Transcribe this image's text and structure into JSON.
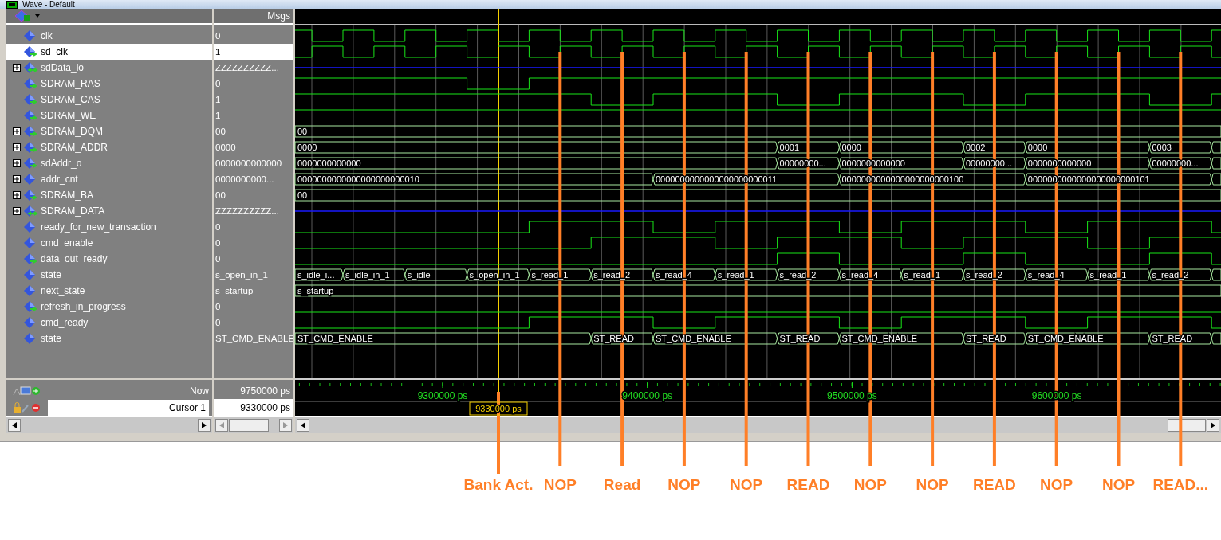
{
  "window": {
    "title": "Wave - Default"
  },
  "header": {
    "values_heading": "Msgs"
  },
  "signals": [
    {
      "name": "clk",
      "value": "0",
      "output": false,
      "bidirectional": false,
      "expandable": false,
      "selected": false,
      "kind": "bit"
    },
    {
      "name": "sd_clk",
      "value": "1",
      "output": true,
      "bidirectional": false,
      "expandable": false,
      "selected": true,
      "kind": "bit"
    },
    {
      "name": "sdData_io",
      "value": "ZZZZZZZZZZ...",
      "output": false,
      "bidirectional": true,
      "expandable": true,
      "selected": false,
      "kind": "hiz"
    },
    {
      "name": "SDRAM_RAS",
      "value": "0",
      "output": true,
      "bidirectional": false,
      "expandable": false,
      "selected": false,
      "kind": "bit"
    },
    {
      "name": "SDRAM_CAS",
      "value": "1",
      "output": true,
      "bidirectional": false,
      "expandable": false,
      "selected": false,
      "kind": "bit"
    },
    {
      "name": "SDRAM_WE",
      "value": "1",
      "output": true,
      "bidirectional": false,
      "expandable": false,
      "selected": false,
      "kind": "bit"
    },
    {
      "name": "SDRAM_DQM",
      "value": "00",
      "output": true,
      "bidirectional": false,
      "expandable": true,
      "selected": false,
      "kind": "bus",
      "segments": [
        "00"
      ]
    },
    {
      "name": "SDRAM_ADDR",
      "value": "0000",
      "output": true,
      "bidirectional": false,
      "expandable": true,
      "selected": false,
      "kind": "bus",
      "segments": [
        "0000",
        "0001",
        "0000",
        "0002",
        "0000",
        "0003"
      ]
    },
    {
      "name": "sdAddr_o",
      "value": "0000000000000",
      "output": true,
      "bidirectional": false,
      "expandable": true,
      "selected": false,
      "kind": "bus",
      "segments": [
        "0000000000000",
        "00000000...",
        "0000000000000",
        "00000000...",
        "0000000000000",
        "00000000..."
      ]
    },
    {
      "name": "addr_cnt",
      "value": "0000000000...",
      "output": false,
      "bidirectional": false,
      "expandable": true,
      "selected": false,
      "kind": "bus",
      "segments": [
        "0000000000000000000000010",
        "0000000000000000000000011",
        "0000000000000000000000100",
        "0000000000000000000000101"
      ]
    },
    {
      "name": "SDRAM_BA",
      "value": "00",
      "output": true,
      "bidirectional": false,
      "expandable": true,
      "selected": false,
      "kind": "bus",
      "segments": [
        "00"
      ]
    },
    {
      "name": "SDRAM_DATA",
      "value": "ZZZZZZZZZZ...",
      "output": false,
      "bidirectional": true,
      "expandable": true,
      "selected": false,
      "kind": "hiz"
    },
    {
      "name": "ready_for_new_transaction",
      "value": "0",
      "output": false,
      "bidirectional": false,
      "expandable": false,
      "selected": false,
      "kind": "bit"
    },
    {
      "name": "cmd_enable",
      "value": "0",
      "output": false,
      "bidirectional": false,
      "expandable": false,
      "selected": false,
      "kind": "bit"
    },
    {
      "name": "data_out_ready",
      "value": "0",
      "output": true,
      "bidirectional": false,
      "expandable": false,
      "selected": false,
      "kind": "bit"
    },
    {
      "name": "state",
      "value": "s_open_in_1",
      "output": false,
      "bidirectional": false,
      "expandable": false,
      "selected": false,
      "kind": "bus",
      "segments": [
        "s_idle_i...",
        "s_idle_in_1",
        "s_idle",
        "s_open_in_1",
        "s_read_1",
        "s_read_2",
        "s_read_4",
        "s_read_1",
        "s_read_2",
        "s_read_4",
        "s_read_1",
        "s_read_2",
        "s_read_4",
        "s_read_1",
        "s_read_2"
      ]
    },
    {
      "name": "next_state",
      "value": "s_startup",
      "output": false,
      "bidirectional": false,
      "expandable": false,
      "selected": false,
      "kind": "bus",
      "segments": [
        "s_startup"
      ]
    },
    {
      "name": "refresh_in_progress",
      "value": "0",
      "output": true,
      "bidirectional": false,
      "expandable": false,
      "selected": false,
      "kind": "bit"
    },
    {
      "name": "cmd_ready",
      "value": "0",
      "output": false,
      "bidirectional": false,
      "expandable": false,
      "selected": false,
      "kind": "bit"
    },
    {
      "name": "state",
      "value": "ST_CMD_ENABLE",
      "output": false,
      "bidirectional": false,
      "expandable": false,
      "selected": false,
      "kind": "bus",
      "segments": [
        "ST_CMD_ENABLE",
        "ST_READ",
        "ST_CMD_ENABLE",
        "ST_READ",
        "ST_CMD_ENABLE",
        "ST_READ",
        "ST_CMD_ENABLE",
        "ST_READ"
      ]
    }
  ],
  "timeline": {
    "now_label": "Now",
    "now_value": "9750000 ps",
    "cursor_label": "Cursor 1",
    "cursor_value": "9330000 ps",
    "ticks": [
      "9300000 ps",
      "9400000 ps",
      "9500000 ps",
      "9600000 ps"
    ],
    "cursor_marker": "9330000 ps"
  },
  "annotations": [
    {
      "label": "Bank Act."
    },
    {
      "label": "NOP"
    },
    {
      "label": "Read"
    },
    {
      "label": "NOP"
    },
    {
      "label": "NOP"
    },
    {
      "label": "READ"
    },
    {
      "label": "NOP"
    },
    {
      "label": "NOP"
    },
    {
      "label": "READ"
    },
    {
      "label": "NOP"
    },
    {
      "label": "NOP"
    },
    {
      "label": "READ..."
    }
  ]
}
